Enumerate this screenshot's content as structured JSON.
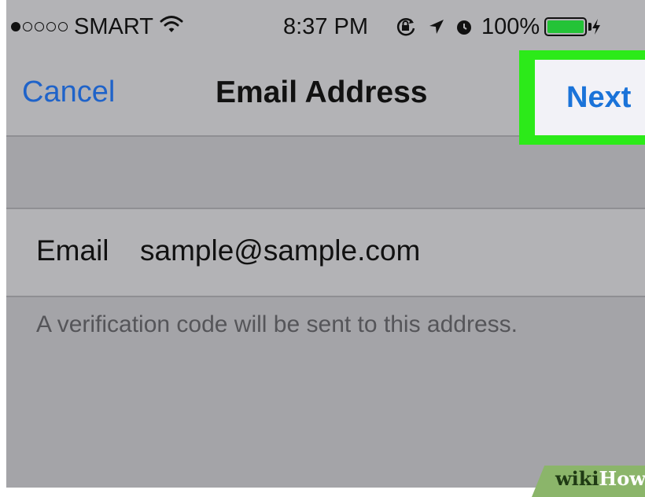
{
  "status_bar": {
    "signal_dots_filled": 1,
    "signal_dots_total": 5,
    "carrier": "SMART",
    "time": "8:37 PM",
    "battery": "100%",
    "battery_level_percent": 100,
    "icons": [
      "wifi-icon",
      "orientation-lock-icon",
      "location-arrow-icon",
      "alarm-icon",
      "battery-icon",
      "charging-icon"
    ],
    "battery_color": "#24c337"
  },
  "nav": {
    "cancel_label": "Cancel",
    "title": "Email Address",
    "next_label": "Next",
    "highlight_color": "#2cea19",
    "accent_color": "#1a73d9"
  },
  "form": {
    "email_label": "Email",
    "email_value": "sample@sample.com",
    "footnote": "A verification code will be sent to this address."
  },
  "watermark": {
    "brand_left": "wiki",
    "brand_right": "How"
  }
}
